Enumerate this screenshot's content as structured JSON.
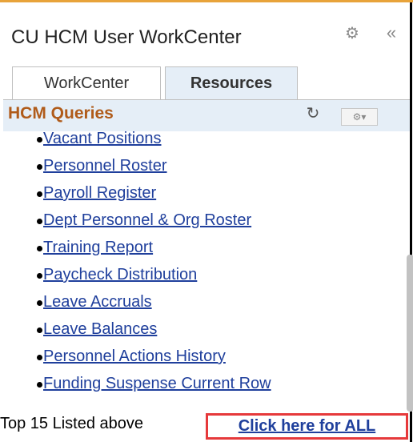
{
  "window": {
    "title": "CU HCM User WorkCenter",
    "gear_icon": "gear-icon",
    "collapse_label": "«"
  },
  "tabs": [
    {
      "label": "WorkCenter",
      "active": false
    },
    {
      "label": "Resources",
      "active": true
    }
  ],
  "pagelet": {
    "title": "HCM Queries",
    "refresh_icon": "refresh-icon",
    "options_label": "⚙▾"
  },
  "queries": [
    "Vacant Positions",
    "Personnel Roster",
    "Payroll Register",
    "Dept Personnel & Org Roster",
    "Training Report",
    "Paycheck Distribution",
    "Leave Accruals",
    "Leave Balances",
    "Personnel Actions History",
    "Funding Suspense Current Row"
  ],
  "footer": {
    "text": "Top 15 Listed above",
    "link_label": "Click here for ALL"
  },
  "colors": {
    "accent_orange": "#b05b1a",
    "link_blue": "#1f3f9c",
    "highlight_red": "#e6393b",
    "tab_bg": "#e5eef7"
  }
}
